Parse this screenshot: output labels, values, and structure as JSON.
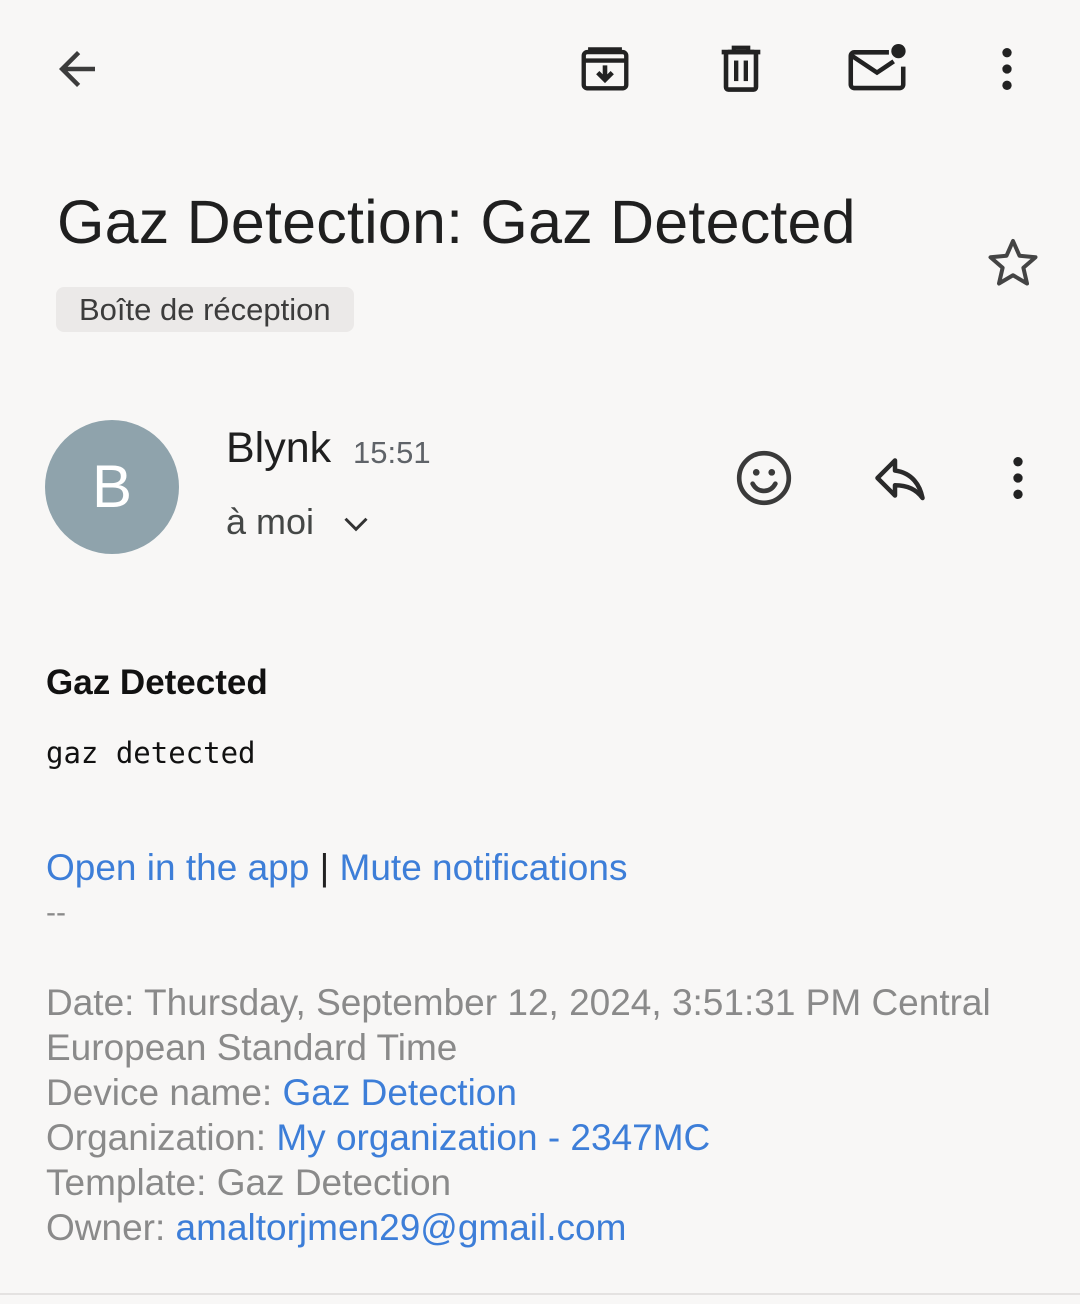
{
  "toolbar": {
    "back_icon": "arrow-left-icon",
    "archive_icon": "archive-icon",
    "delete_icon": "trash-icon",
    "mark_unread_icon": "mail-unread-icon",
    "more_icon": "more-vert-icon"
  },
  "email": {
    "subject": "Gaz Detection: Gaz Detected",
    "label": "Boîte de réception",
    "star_icon": "star-outline-icon"
  },
  "sender": {
    "avatar_letter": "B",
    "avatar_color": "#8fa3ac",
    "name": "Blynk",
    "time": "15:51",
    "recipient": "à moi",
    "actions": {
      "emoji_icon": "emoji-reaction-icon",
      "reply_icon": "reply-icon",
      "more_icon": "more-vert-icon"
    }
  },
  "body": {
    "title": "Gaz Detected",
    "text": "gaz detected",
    "open_app_link": "Open in the app",
    "separator": "|",
    "mute_link": "Mute notifications",
    "signature_dashes": "--",
    "meta": {
      "date_text": "Date: Thursday, September 12, 2024, 3:51:31 PM Central European Standard Time",
      "device_label": "Device name: ",
      "device_value": "Gaz Detection",
      "org_label": "Organization: ",
      "org_value": "My organization - 2347MC",
      "template_text": "Template: Gaz Detection",
      "owner_label": "Owner: ",
      "owner_value": "amaltorjmen29@gmail.com"
    }
  },
  "colors": {
    "link": "#3d7ed8",
    "muted_text": "#8a8a8a",
    "background": "#f8f7f6"
  }
}
